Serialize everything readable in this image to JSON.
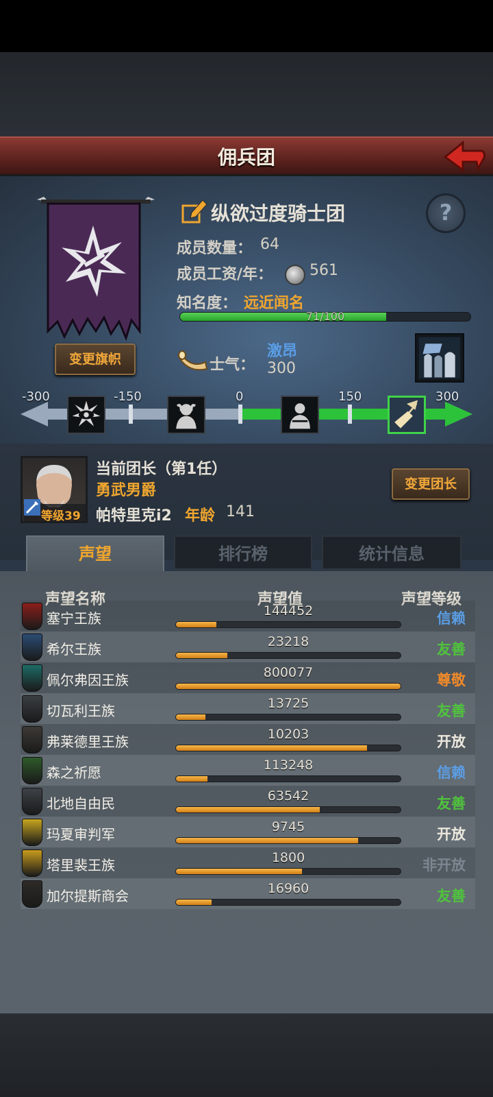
{
  "header": {
    "title": "佣兵团"
  },
  "guild": {
    "name": "纵欲过度骑士团",
    "help_label": "?",
    "change_flag_label": "变更旗帜",
    "members_label": "成员数量：",
    "members_value": "64",
    "wage_label": "成员工资/年：",
    "wage_value": "561",
    "fame_label": "知名度：",
    "fame_value": "远近闻名",
    "fame_progress_text": "71/100",
    "fame_progress": 0.71,
    "morale_label": "士气：",
    "morale_state": "激昂",
    "morale_value": "300",
    "morale_scale": [
      "-300",
      "-150",
      "0",
      "150",
      "300"
    ],
    "morale_fraction": 1.0
  },
  "leader": {
    "title": "当前团长（第1任）",
    "rank": "勇武男爵",
    "name": "帕特里克i2",
    "age_label": "年龄",
    "age_value": "141",
    "level_text": "等级39",
    "change_leader_label": "变更团长"
  },
  "tabs": [
    {
      "label": "声望",
      "active": true
    },
    {
      "label": "排行榜",
      "active": false
    },
    {
      "label": "统计信息",
      "active": false
    }
  ],
  "reputation": {
    "headers": {
      "name": "声望名称",
      "value": "声望值",
      "level": "声望等级"
    },
    "rows": [
      {
        "name": "塞宁王族",
        "value": "144452",
        "progress": 0.18,
        "level": "信赖",
        "level_color": "#5b9ee6",
        "icon_color": "#8a1f1a",
        "icon": "crest-icon"
      },
      {
        "name": "希尔王族",
        "value": "23218",
        "progress": 0.23,
        "level": "友善",
        "level_color": "#4fc43c",
        "icon_color": "#2b4c74",
        "icon": "crest-icon"
      },
      {
        "name": "佩尔弗因王族",
        "value": "800077",
        "progress": 1.0,
        "level": "尊敬",
        "level_color": "#f08a2a",
        "icon_color": "#1e6b66",
        "icon": "crest-icon"
      },
      {
        "name": "切瓦利王族",
        "value": "13725",
        "progress": 0.13,
        "level": "友善",
        "level_color": "#4fc43c",
        "icon_color": "#3a3e42",
        "icon": "crest-icon"
      },
      {
        "name": "弗莱德里王族",
        "value": "10203",
        "progress": 0.85,
        "level": "开放",
        "level_color": "#ece8de",
        "icon_color": "#3d3a36",
        "icon": "crest-icon"
      },
      {
        "name": "森之祈愿",
        "value": "113248",
        "progress": 0.14,
        "level": "信赖",
        "level_color": "#5b9ee6",
        "icon_color": "#2e5a2a",
        "icon": "crest-icon"
      },
      {
        "name": "北地自由民",
        "value": "63542",
        "progress": 0.64,
        "level": "友善",
        "level_color": "#4fc43c",
        "icon_color": "#3e4247",
        "icon": "crest-icon"
      },
      {
        "name": "玛夏审判军",
        "value": "9745",
        "progress": 0.81,
        "level": "开放",
        "level_color": "#ece8de",
        "icon_color": "#c7a51e",
        "icon": "crest-icon"
      },
      {
        "name": "塔里裴王族",
        "value": "1800",
        "progress": 0.56,
        "level": "非开放",
        "level_color": "#7d8690",
        "icon_color": "#c89b1c",
        "icon": "crest-icon"
      },
      {
        "name": "加尔提斯商会",
        "value": "16960",
        "progress": 0.16,
        "level": "友善",
        "level_color": "#4fc43c",
        "icon_color": "#2e2b28",
        "icon": "crest-icon"
      }
    ]
  }
}
